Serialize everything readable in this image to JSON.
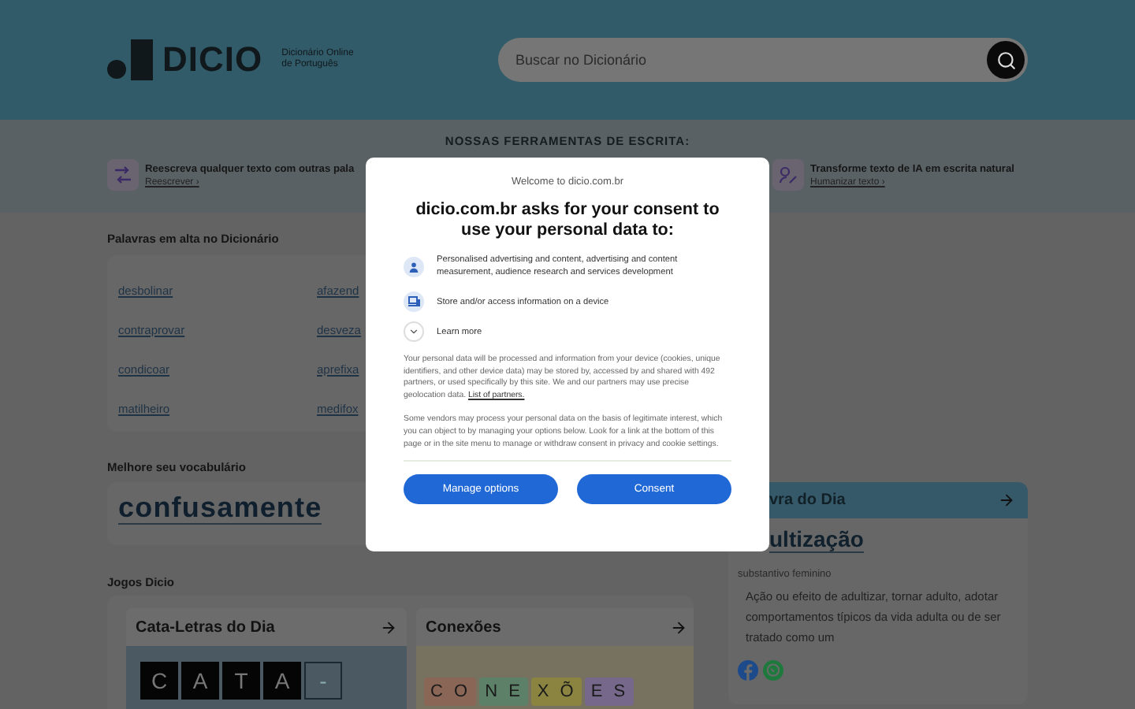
{
  "header": {
    "logo": "DICIO",
    "tagline": [
      "Dicionário Online",
      "de Português"
    ],
    "search": {
      "placeholder": "Buscar no Dicionário"
    }
  },
  "tools": {
    "title": "NOSSAS FERRAMENTAS DE ESCRITA:",
    "items": [
      {
        "kind": "rewrite",
        "text": "Reescreva qualquer texto com outras pala",
        "link": "Reescrever ›"
      },
      {
        "kind": "humanize",
        "text": "Transforme texto de IA em escrita natural",
        "link": "Humanizar texto ›"
      }
    ]
  },
  "trending": {
    "title": "Palavras em alta no Dicionário",
    "words": [
      "desbolinar",
      "afazend",
      "contraprovar",
      "desveza",
      "condicoar",
      "aprefixa",
      "matilheiro",
      "medifox"
    ]
  },
  "vocabulary": {
    "title": "Melhore seu vocabulário",
    "word": "confusamente"
  },
  "games": {
    "title": "Jogos Dicio",
    "items": [
      {
        "kind": "letters",
        "title": "Cata-Letras do Dia",
        "tiles": [
          {
            "letter": "C",
            "filled": true
          },
          {
            "letter": "A",
            "filled": true
          },
          {
            "letter": "T",
            "filled": true
          },
          {
            "letter": "A",
            "filled": true
          },
          {
            "letter": "-",
            "filled": false
          }
        ]
      },
      {
        "kind": "groups",
        "title": "Conexões",
        "tiles": [
          {
            "letter": "C O",
            "color": "#8a6657"
          },
          {
            "letter": "N E",
            "color": "#5c8068"
          },
          {
            "letter": "X Õ",
            "color": "#8a8440"
          },
          {
            "letter": "E S",
            "color": "#75688a"
          }
        ]
      }
    ]
  },
  "word_of_day": {
    "title": "vra do Dia",
    "word": "ultização",
    "class": "substantivo feminino",
    "definition": "Ação ou efeito de adultizar, tornar adulto, adotar comportamentos típicos da vida adulta ou de ser tratado como um"
  },
  "consent": {
    "welcome": "Welcome to dicio.com.br",
    "heading": "dicio.com.br asks for your consent to use your personal data to:",
    "purposes": [
      {
        "kind": "person",
        "text": "Personalised advertising and content, advertising and content measurement, audience research and services development"
      },
      {
        "kind": "device",
        "text": "Store and/or access information on a device"
      }
    ],
    "learn_more": "Learn more",
    "paragraph_1": "Your personal data will be processed and information from your device (cookies, unique identifiers, and other device data) may be stored by, accessed by and shared with 492 partners, or used specifically by this site. We and our partners may use precise geolocation data.",
    "partners_link": "List of partners.",
    "paragraph_2": "Some vendors may process your personal data on the basis of legitimate interest, which you can object to by managing your options below. Look for a link at the bottom of this page or in the site menu to manage or withdraw consent in privacy and cookie settings.",
    "buttons": [
      "Manage options",
      "Consent"
    ]
  }
}
